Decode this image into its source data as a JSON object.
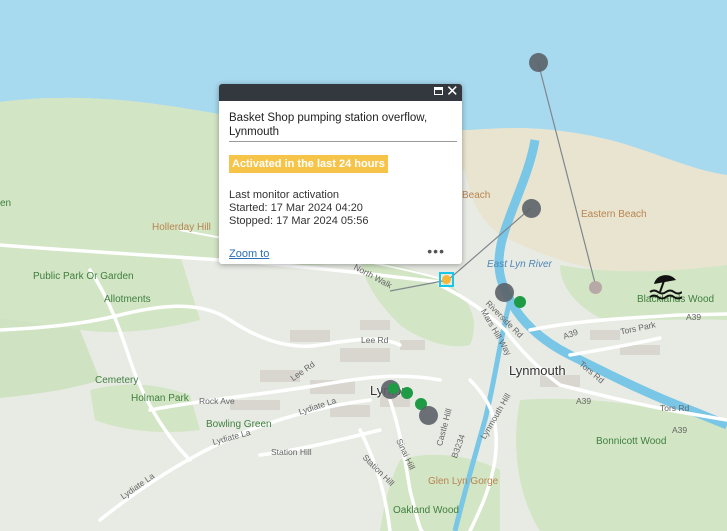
{
  "map": {
    "labels": {
      "hollerday_hill": "Hollerday Hill",
      "public_park": "Public Park Or Garden",
      "allotments": "Allotments",
      "cemetery": "Cemetery",
      "holman_park": "Holman Park",
      "bowling_green": "Bowling Green",
      "lynton": "Lynton",
      "lynmouth": "Lynmouth",
      "east_lyn_river": "East Lyn River",
      "eastern_beach": "Eastern Beach",
      "beach": "Beach",
      "blacklands_wood": "Blacklands Wood",
      "bonnicott_wood": "Bonnicott Wood",
      "glen_lyn_gorge": "Glen Lyn Gorge",
      "oakland_wood": "Oakland Wood",
      "en": "en",
      "north_walk": "North Walk",
      "lee_rd": "Lee Rd",
      "lee_rd2": "Lee Rd",
      "rock_ave": "Rock Ave",
      "lydiate_la": "Lydiate La",
      "lydiate_la2": "Lydiate La",
      "lydiate_la3": "Lydiate La",
      "station_hill": "Station Hill",
      "station_hill2": "Station Hill",
      "sinai_hill": "Sinai Hill",
      "castle_hill": "Castle Hill",
      "b3234": "B3234",
      "lynmouth_hill": "Lynmouth Hill",
      "riverside_rd": "Riverside Rd",
      "mars_hill_way": "Mars Hill Way",
      "tors_park": "Tors Park",
      "tors_rd": "Tors Rd",
      "tors_rd2": "Tors Rd",
      "a39a": "A39",
      "a39b": "A39",
      "a39c": "A39",
      "a39d": "A39"
    },
    "colors": {
      "sea": "#a7d9ef",
      "land": "#e8ebe4",
      "beach": "#e8e4cf",
      "green": "#d2e5c4",
      "river": "#79c6e6",
      "road": "#ffffff",
      "marker_active": "#f4b73b",
      "marker_ok": "#1f9b45",
      "marker_inactive": "#5b6268",
      "selection": "#19c6ea"
    }
  },
  "popup": {
    "title": "Basket Shop pumping station overflow, Lynmouth",
    "status_badge": "Activated in the last 24 hours",
    "detail_heading": "Last monitor activation",
    "started": "Started: 17 Mar 2024 04:20",
    "stopped": "Stopped: 17 Mar 2024 05:56",
    "zoom_link": "Zoom to",
    "more": "•••",
    "maximize_icon": "maximize-icon",
    "close_icon": "close-icon"
  }
}
